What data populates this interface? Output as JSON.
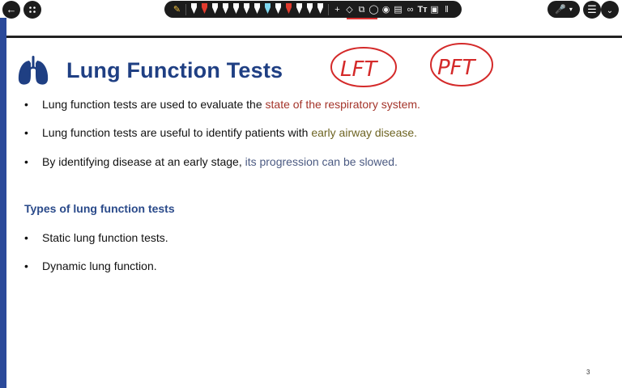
{
  "toolbar": {
    "back_icon": "back-arrow-icon",
    "grid_icon": "grid-menu-icon",
    "pen_colors": [
      "#ffffff",
      "#e23b2e",
      "#ffffff",
      "#ffffff",
      "#ffffff",
      "#ffffff",
      "#ffffff",
      "#7fd7f0",
      "#ffffff",
      "#e23b2e",
      "#ffffff",
      "#ffffff",
      "#ffffff"
    ],
    "mic_icon": "microphone-icon",
    "menu_icon": "menu-icon",
    "chevron_icon": "chevron-down-icon",
    "text_tool_label": "Tт"
  },
  "slide": {
    "title": "Lung Function Tests",
    "bullets": [
      {
        "text": "Lung function tests are used to evaluate the ",
        "highlight": "state of the respiratory system."
      },
      {
        "text": "Lung function tests are useful to identify patients with ",
        "highlight": "early airway disease."
      },
      {
        "text": "By identifying disease at an early stage, ",
        "highlight": "its progression can be slowed."
      }
    ],
    "subheading": "Types of lung function tests",
    "types": [
      "Static lung function tests.",
      "Dynamic lung function."
    ],
    "page_number": "3",
    "colors": {
      "title": "#1f3f83",
      "highlight_red": "#a4342a",
      "highlight_olive": "#6e6422",
      "highlight_slate": "#4b5a82"
    }
  },
  "annotations": {
    "lft": "LFT",
    "pft": "PFT",
    "ink_color": "#d42a2a"
  }
}
